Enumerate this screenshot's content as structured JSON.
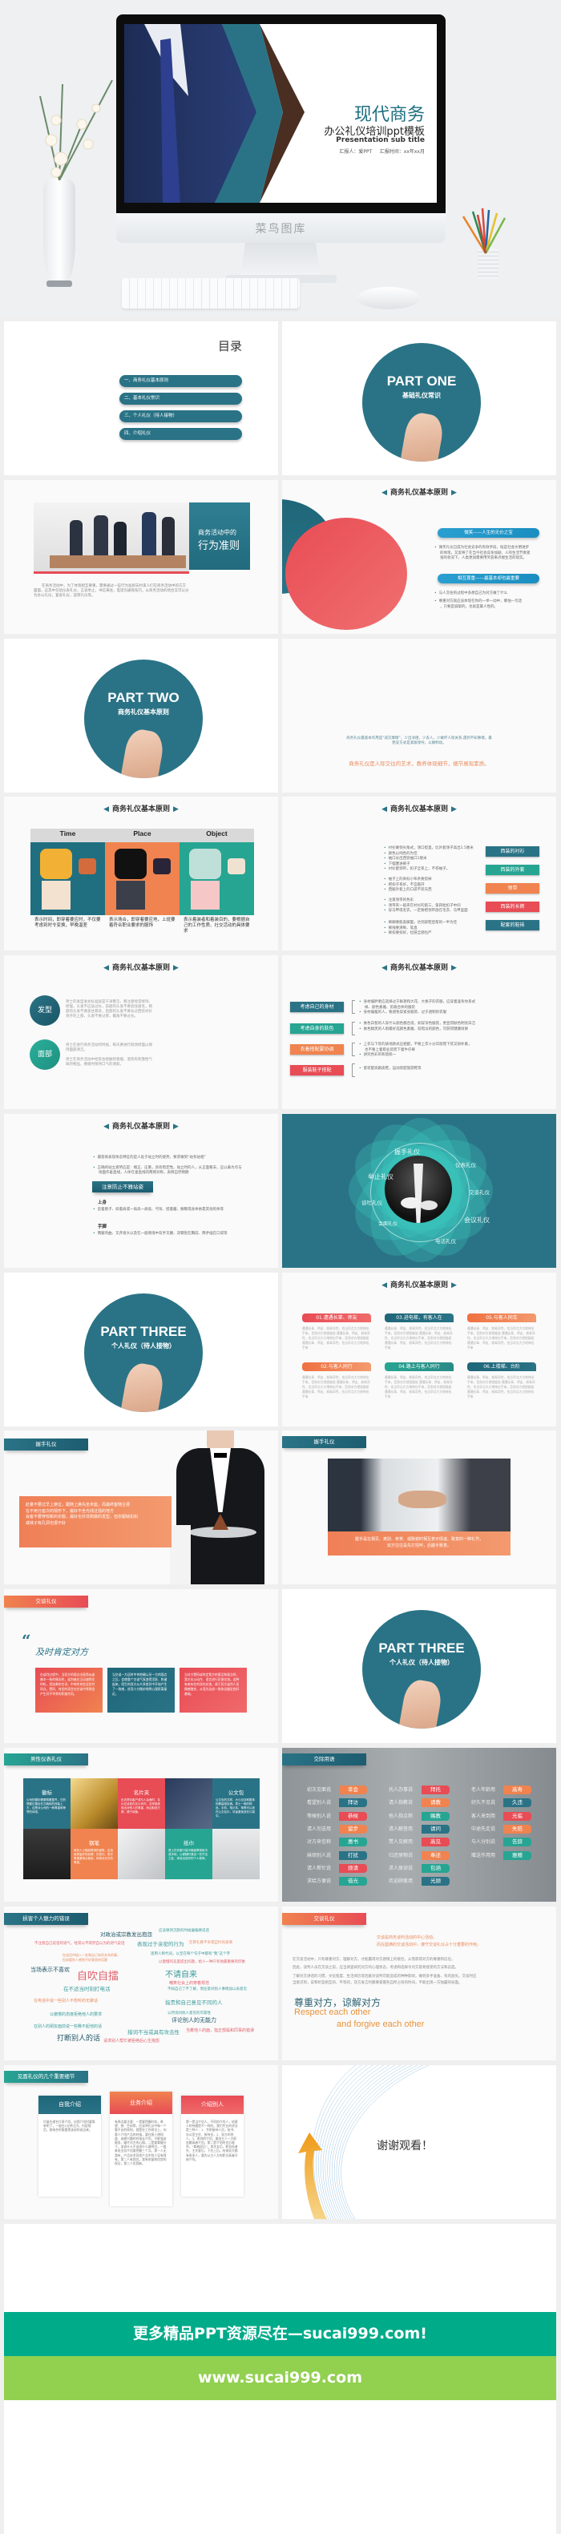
{
  "colors": {
    "teal": "#2a7386",
    "green": "#27a593",
    "orange": "#f0834f",
    "red": "#e84c55",
    "banner_teal": "#00ab8a",
    "banner_green": "#92d050"
  },
  "hero": {
    "title": "现代商务",
    "subtitle": "办公礼仪培训ppt模板",
    "en_subtitle": "Presentation sub title",
    "reporter": "汇报人：爱PPT",
    "report_time": "汇报时间：xx年xx月",
    "chin_watermark": "菜鸟图库"
  },
  "principle_header": "商务礼仪基本原则",
  "toc": {
    "title": "目录",
    "items": [
      "一、商务礼仪基本原则",
      "二、基本礼仪常识",
      "三、个人礼仪（待人接物）",
      "四、介绍礼仪"
    ]
  },
  "part_one": {
    "title": "PART ONE",
    "subtitle": "基础礼仪常识"
  },
  "conduct": {
    "line1": "商务活动中的",
    "line2": "行为准则",
    "paragraph": "在商务活动中，为了体现相互尊重，需要通过一些行为准则去约束人们在商务活动中的方方面面，这其中包括仪表礼仪，言谈举止，书信来往，电话沟通等技巧，从商务活动的场合又可以分为办公礼仪，宴会礼仪，迎宾礼仪等。"
  },
  "smile": {
    "pill1": "微笑——人生的无价之宝",
    "bullets1": [
      "微笑礼仪已成为社会竞争的有效手段，既是社会文明进步",
      "的体现，又反映了在当今社会竞争加剧、人的生活节奏紧",
      "张的状况下，人类更加需要用笑容来点缀生活的现实。"
    ],
    "pill2": "相互尊重——最基本却也最重要",
    "bullets2": [
      "与人交往的过程中多想自己为对方做了什么",
      "尊重对方就应该体现在你的一举一动中，哪怕一句话",
      "，只要是诚挚的，也就是最人性的。"
    ]
  },
  "part_two": {
    "title": "PART TWO",
    "subtitle": "商务礼仪基本原则"
  },
  "quote_slide": {
    "note1": "商务礼仪最基本作用是“减交摩擦”，少出洋相，少丢人，少做坏人际关系,遇到不知事情，最",
    "note2": "稳妥方式是紧跟领导，以静制动。",
    "highlight": "商务礼仪是人际交往的艺术，教养体现细节，细节展现素质。"
  },
  "tpo": {
    "columns": [
      {
        "label": "Time",
        "caption": "表示时间，即穿着要应时，不仅要考虑到时令变换，早晚温差"
      },
      {
        "label": "Place",
        "caption": "表示场合，即穿着要应地，上班要着符合职业要求的服饰"
      },
      {
        "label": "Object",
        "caption": "表示着装者和着装目的，要根据自己的工作性质、社交活动的具体要求"
      }
    ]
  },
  "suit": {
    "buttons": [
      "西装的衬衫",
      "西装的外套",
      "领带",
      "西装的长裤",
      "配套的鞋袜"
    ],
    "groups": [
      [
        "衬衫硬领尖角式，领口挺直，比外套领子高出1.5厘米",
        "颜色以纯色的为佳",
        "袖口长出西装袖口1厘米",
        "下摆塞进裤子",
        "衬衫配领带，扣子全系上，不卷袖子。"
      ],
      [
        "袖子上的商标小布条要剪掉",
        "把扣子系好，不宜敞开",
        "西服外套上的口袋不装东西"
      ],
      [
        "注意领带的色彩",
        "领带夹一般夹在衬衫的第三、第四粒扣子中间",
        "穿马甲或毛衣，一定要把领带放在毛衣、马甲里面"
      ],
      [
        "裤脚要能盖脚面，达到皮鞋后帮的一半为佳",
        "裤线要清晰、笔直",
        "裤扣要扣好，拉链全部拉严"
      ]
    ]
  },
  "grooming": {
    "items": [
      {
        "label": "发型",
        "text": "男士的发型发式标准就是干净整洁，要注意经常修饰、修理，头发不应该过长，前部的头发不要遮住眉毛，侧部的头发不要盖住耳朵，后部的头发不要长过西装衬衫领子的上部，头发不要过厚，鬓角不要过长。"
      },
      {
        "label": "面部",
        "text": "男士在进行商务活动的时候，每天要进行剃须修面以保持面部清洁。",
        "text2": "男士在商务活动中经常会接触到香烟、酒等有刺激性气味的物品，要随时保持口气的清新。"
      }
    ]
  },
  "dressing": {
    "items": [
      {
        "label": "考虑自己的身材",
        "bullets": [
          "身材偏胖者应选择过于鲜艳和大花、大格子的衣服，应穿着竖条纹系式",
          "样、颜色素雅、剪裁合体的服装",
          "身材偏瘦的人，要避免穿紧身服装、过于透明的衣服"
        ]
      },
      {
        "label": "考虑自身的肤色",
        "bullets": [
          "肤色白皙的人穿什么颜色都合适，如穿深色服装，更显得肤色明亮白洁",
          "肤色黝黑的人则最好选颜色素雅、较暗淡的颜色，可获得健康效果"
        ]
      },
      {
        "label": "衣着搭配要协调",
        "bullets": [
          "上衣与下装的质地款式应相配，不要上衣十分华丽而下装又很朴素，",
          "也不要上着职业装而下着牛仔裤",
          "讲究色彩的和谐统一"
        ]
      },
      {
        "label": "服装鞋子搭配",
        "bullets": [
          "套装配高跟皮鞋，运动装配旅游鞋等"
        ]
      }
    ]
  },
  "standing": {
    "bullet1": "最容易表现体态特征的是人处于站立时的姿势，要求做到“站有站相”",
    "bullet2a": "正确的站立姿势应是：端正、庄重，具有稳定性。站立时的人，从正面看去，应以鼻为点与",
    "bullet2b": "地面作垂直线，人体在垂直线的两侧对称，表情自然明朗",
    "button": "注意防止不雅站姿",
    "upper_label": "上身",
    "upper_bullet": "歪着脖子、斜着肩或一肩高一肩低、弓背、挺着腹、撅臀或身体依靠其他的体等",
    "feet_label": "手脚",
    "feet_bullet": "两腿弯曲、叉开很大以及在一般情境中双手叉腰、双臂抱在胸前、两手插在口袋等"
  },
  "etiquette_flower": {
    "labels": [
      "握手礼仪",
      "仪表礼仪",
      "举止礼仪",
      "交谈礼仪",
      "谈吐礼仪",
      "会议礼仪",
      "会面礼仪",
      "电话礼仪"
    ]
  },
  "part_three": {
    "title": "PART THREE",
    "subtitle": "个人礼仪（待人接物）"
  },
  "guest_cards": {
    "cards": [
      {
        "title": "01.遭遇长辈、师友",
        "color": "red"
      },
      {
        "title": "03.进电梯，有客人在",
        "color": "teal"
      },
      {
        "title": "05.与客人同车",
        "color": "orange"
      },
      {
        "title": "02.与客人同行",
        "color": "orange"
      },
      {
        "title": "04.路上与客人同行",
        "color": "green"
      },
      {
        "title": "06.上楼梯、台阶",
        "color": "teal"
      }
    ],
    "body": "遭遇长辈、师友、前辈异性，也当早点大方地伸出手来，否则对方就很尴尬 遭遇长辈、师友、前辈异性，也当早点大方地伸出手来，否则对方就很尴尬 遭遇长辈、师友、前辈异性，也当早点大方地伸出手来"
  },
  "handshake_waiter": {
    "tab": "握手礼仪",
    "lines": [
      "赴宴不要过早上席位，跟随上席先坐末座，而最终客随主便",
      "在不用分座次的情形下，最好不坐光线过强的地方",
      "会客不要穿较新的衣服，最好也并非刚做的发型，但衣服缺扣扣",
      "或袜子有孔洞也很不好"
    ]
  },
  "handshake_photo": {
    "tab": "握手礼仪",
    "lines": [
      "握手是在相见、离别、恭贺、或致谢时相互表示情谊、致意的一种礼节，",
      "双方往往是先打招呼，后握手致意。"
    ]
  },
  "affirm": {
    "tab": "交谈礼仪",
    "quote_title": "及时肯定对方",
    "boxes": [
      "在谈判过程中，当双方的观点出现类似或基本一致的情况时，谈判者应当迅速抓住时机，用溢美的言词，中肯的肯定这些共同点。赞同、肯定的语言在交谈中常常会产生异乎寻常的积极作用。",
      "当交谈一方适时中肯地确认另一方的观点之后，会使整个交谈气氛变得活跃、和谐起来，陌生的双方从众多差异中开始产生了一致感，进而十分微妙地将心理距离接近。",
      "当对方赞同或肯定我方的意见和观点时，我方应以动作、语言进行反馈交流。这种有来有往的双向交流，易于双方谈判人员情感融合，从而为达成一致协议奠定良好基础。"
    ]
  },
  "male_appearance": {
    "tab": "男性仪表礼仪",
    "cells": [
      {
        "title": "徽标",
        "text": "公司的徽标需要佩戴整齐，它的佩戴位置应在左胸前的西装上方，这是对公司的一种尊重和荣誉的体现。",
        "color": "teal"
      },
      {
        "image": "pen"
      },
      {
        "title": "名片夹",
        "text": "出去拜访客户或与人会面时，名片应该放在名片夹内，这样能体现出对别人的尊重，而且取放方便，便于保管。",
        "color": "red"
      },
      {
        "image": "man-gloves"
      },
      {
        "title": "公文包",
        "text": "公文包的式样、大小应该和整体的着装相协调。男士一般的物品，手机、笔记本、笔等可以放在公文包中，尽量避免放在口袋中。",
        "color": "teal"
      },
      {
        "image": "suit"
      },
      {
        "title": "钢笔",
        "text": "商务人士随身携带的钢笔，应选用质量好的品牌，在签约、签字等重要场合使用，体现对对方的尊重。",
        "color": "orange"
      },
      {
        "image": "card-holder"
      },
      {
        "title": "纸巾",
        "text": "男士在衣服口袋中随身携带纸巾或手帕，以便随时清洁一些不洁之处，体现出良好的个人修养。",
        "color": "green"
      },
      {
        "image": "briefcase"
      }
    ]
  },
  "phrases": {
    "tab": "交际用语",
    "columns": [
      [
        [
          "初次见面说",
          "幸会",
          "orange"
        ],
        [
          "看望别人说",
          "拜访",
          "teal"
        ],
        [
          "等候别人说",
          "恭候",
          "red"
        ],
        [
          "请人勿送用",
          "留步",
          "orange"
        ],
        [
          "对方来信称",
          "惠书",
          "green"
        ],
        [
          "麻烦别人说",
          "打扰",
          "teal"
        ],
        [
          "请人帮忙说",
          "烦请",
          "red"
        ],
        [
          "求给方便说",
          "借光",
          "green"
        ]
      ],
      [
        [
          "托人办事说",
          "拜托",
          "red"
        ],
        [
          "请人指教说",
          "请教",
          "orange"
        ],
        [
          "他人指点称",
          "赐教",
          "green"
        ],
        [
          "请人解答用",
          "请问",
          "teal"
        ],
        [
          "赞人见解用",
          "高见",
          "red"
        ],
        [
          "归还原物说",
          "奉还",
          "orange"
        ],
        [
          "求人原谅说",
          "包涵",
          "green"
        ],
        [
          "欢迎顾客用",
          "光顾",
          "teal"
        ]
      ],
      [
        [
          "老人年龄用",
          "高寿",
          "orange"
        ],
        [
          "好久不见说",
          "久违",
          "teal"
        ],
        [
          "客人来到用",
          "光临",
          "red"
        ],
        [
          "中途先走说",
          "失陪",
          "orange"
        ],
        [
          "与人分别说",
          "告辞",
          "green"
        ],
        [
          "赠送作用用",
          "雅赠",
          "green"
        ]
      ]
    ]
  },
  "mistakes": {
    "tab": "损害个人魅力的错误",
    "words": [
      [
        "对政治或宗教发出抱怨",
        "dark"
      ],
      [
        "应该保持沉默的时候偏偏要说话",
        "teal"
      ],
      [
        "不注意自己说话的语气，经常以不得然自以为的语气说话",
        "red"
      ],
      [
        "表现过于亲密的行为",
        "teal"
      ],
      [
        "在葬礼看不幸或自怜的表情",
        "orange"
      ],
      [
        "在谈话中插入一些和自己有所关系的事，",
        "orange"
      ],
      [
        "但却要别人感到不好意思的话题",
        "orange"
      ],
      [
        "滥用人称代词，以至在每个句子中都有“我”这个字",
        "teal"
      ],
      [
        "以傲慢的态度提出问题，给人一种只有他最重要的印象",
        "red"
      ],
      [
        "当场表示不喜欢",
        "dark"
      ],
      [
        "自吹自擂",
        "red"
      ],
      [
        "不请自来",
        "teal"
      ],
      [
        "嘲笑社会上的穿着规范",
        "red"
      ],
      [
        "不知自己了不了解，而任意对别人事情加以表意见",
        "teal"
      ],
      [
        "在不适当时刻打电话",
        "teal"
      ],
      [
        "在电话中说一些别人不想听的无聊话",
        "orange"
      ],
      [
        "指责和自己意见不同的人",
        "teal"
      ],
      [
        "以傲慢的态度拒绝他人的要求",
        "teal"
      ],
      [
        "公然询问他人意见的可靠性",
        "teal"
      ],
      [
        "评论别人的无能力",
        "dark"
      ],
      [
        "在别人的朋友面前说一些瞧不起他的话",
        "teal"
      ],
      [
        "措词不当或具有攻击性",
        "teal"
      ],
      [
        "当着他人的面，指正部属和同事的错误",
        "red"
      ],
      [
        "打断别人的话",
        "dark"
      ],
      [
        "请求别人帮忙被拒绝后心生抱怨",
        "red"
      ]
    ]
  },
  "conversation": {
    "tab": "交谈礼仪",
    "intro1": "交谈是商务谈判活动的中心活动。",
    "intro2": "而在圆满的交谈活动中，遵守交谈礼仪占十分重要的作用。",
    "p1": "在交谈活动中，只有尊重对方，理解对方，才能赢得对方感情上的接近，从而获得对方的尊重和信任。",
    "p2": "因此，谈判人员在交谈之前，应当调查研究对方的心理状态，考虑和选择令对方容易接受的方法和态度。",
    "p3a": "了解对方讲话的习惯、文化程度、生活阅历等因素对谈判可能造成的种种影响，做到多手准备，有的放矢。交谈时应",
    "p3b": "当意识到，说和听是相互的、平等的，双方发言时都要掌握各自所占有的时间，不能出现一方独霸的局面。",
    "slogan_cn": "尊重对方，谅解对方",
    "slogan_en1": "Respect each other",
    "slogan_en2": "and forgive each other"
  },
  "meeting": {
    "tab": "见面礼仪的几个重要细节",
    "cards": [
      {
        "title": "自我介绍",
        "color": "teal",
        "body": "尽量先递名片再介绍，自我介绍时要简单明了，一般在1分钟之内，内容规范，按场合的需要把该说的说出来。"
      },
      {
        "title": "业务介绍",
        "color": "orange",
        "body": "有两点要注意：一是要把握时机，希望、想、空闲等，应该将礼仪中每一个看不出的原则，就是在工作岗位上，向客人介绍产品的时候，要在客人想知道、或感兴趣的时候去介绍，不能强迫服务，破坏对方的心情。二是要掌握分寸，该说什么不该说什么要明白，一般来说业务介绍要把握三个点。第一人无我有，产品技术同类产品中别人没有我有，第二人有我优，我有质量和优势的保证，第三人优我新。"
      },
      {
        "title": "介绍别人",
        "color": "red",
        "body": "第一是当介绍人，不同的介绍人，给客人的待遇是不一样的，我们专业的讲法是三种人：1、专职接待人员，秘书、办公室主任、接待员，2、双方的熟人，3、贵宾的介绍，要由主人一方职务最高者介绍。第二是介绍的先后顺序，“尊者居后”，男先女后，职务低者先、主先客后，下先上后。给来双方都有很多人，要先从主人方的职位高者开始介绍。"
      }
    ]
  },
  "thanks": {
    "text": "谢谢观看！"
  },
  "footer": {
    "banner": "更多精品PPT资源尽在—sucai999.com!",
    "url": "www.sucai999.com"
  }
}
